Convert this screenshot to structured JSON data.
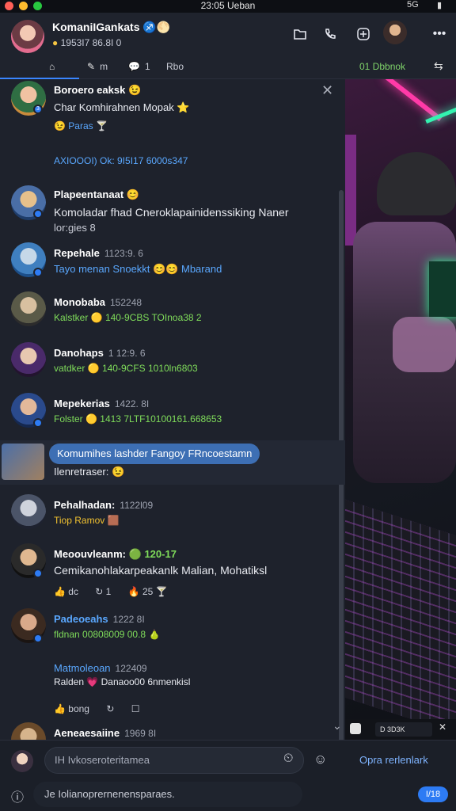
{
  "status_bar": {
    "clock": "23:05 Ueban",
    "right_label": "5G"
  },
  "header": {
    "name": "KomaniIGankats",
    "name_icons": "♐🌕",
    "subtitle_dot": "●",
    "subtitle": "1953I7  86.8I 0"
  },
  "tabs": [
    {
      "icon": "⌂",
      "label": ""
    },
    {
      "icon": "✎",
      "label": "m"
    },
    {
      "icon": "💬",
      "label": "1"
    },
    {
      "icon": "",
      "label": "Rbo"
    }
  ],
  "tab_right": "01 Dbbnok",
  "messages": [
    {
      "name": "Boroero eaksk",
      "emoji": "😉",
      "line1": "Char Komhirahnen Mopak ⭐",
      "line2": "😉 Paras 🍸",
      "line3": "AXIOOOI)  Ok: 9I5I17 6000s347"
    },
    {
      "name": "Plapeentanaat",
      "emoji": "😊",
      "line1": "Komoladar fhad Cneroklapainidenssiking Naner",
      "line2": "lor:gies   8"
    },
    {
      "name": "Repehale",
      "time": "1123:9. 6",
      "line1": "Tayo menan Snoekkt 😊😊 Mbarand"
    },
    {
      "name": "Monobaba",
      "time": "152248",
      "line1": "Kalstker 🟡 140-9CBS TOInoa38 2"
    },
    {
      "name": "Danohaps",
      "time": "1 12:9. 6",
      "line1": "vatdker 🟡 140-9CFS 1010ln6803"
    },
    {
      "name": "Mepekerias",
      "time": "1422. 8I",
      "line1": "Folster 🟡 1413 7LTF10100161.668653"
    },
    {
      "bubble": "Komumihes lashder Fangoy FRncoestamn",
      "line1": "Ilenretraser: 😉"
    },
    {
      "name": "Pehalhadan:",
      "time": "1122l09",
      "line1": "Tiop Ramov 🟫"
    },
    {
      "name": "Meoouvleanm:",
      "emoji_time": "🟢 120-17",
      "line1": "Cemikanohlakarpeakanlk Malian, Mohatiksl",
      "reacts": [
        "👍 dc",
        "↻ 1",
        "🔥 25 🍸"
      ]
    },
    {
      "name": "Padeoeahs",
      "time": "1222 8I",
      "line1": "fldnan 00808009 00.8 🍐"
    },
    {
      "name": "Matmoleoan",
      "time": "122409",
      "line1": "Ralden 💗 Danaoo00 6nmenkisl",
      "reacts": [
        "👍 bong",
        "↻",
        "☐"
      ]
    },
    {
      "name": "Aeneaesaiine",
      "time": "1969 8I"
    }
  ],
  "media_bar": {
    "label": "D 3D3K"
  },
  "composer": {
    "placeholder": "IH Ivkoseroteritamea",
    "link": "Opra rerlenlark",
    "second_placeholder": "Je Iolianoprernenensparaes.",
    "send_label": "I/18"
  }
}
